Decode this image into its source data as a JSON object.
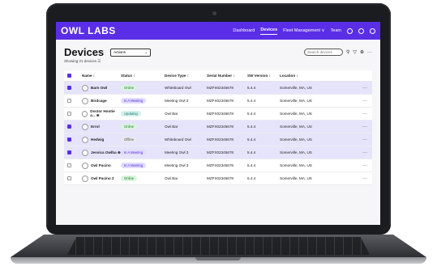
{
  "topbar": {
    "logo": "OWL LABS",
    "nav": [
      "Dashboard",
      "Devices",
      "Fleet Management ∨",
      "Team"
    ]
  },
  "page": {
    "title": "Devices",
    "actions_label": "Actions",
    "search_placeholder": "Search devices",
    "subtitle": "Showing 21 devices ☰"
  },
  "table": {
    "columns": [
      "",
      "Name ↕",
      "Status ↕",
      "Device Type ↕",
      "Serial Number ↕",
      "SW Version ↕",
      "Location ↕",
      ""
    ],
    "rows": [
      {
        "name": "Barn Owl",
        "status": "Online",
        "type": "Whiteboard Owl",
        "serial": "MZFX02345678",
        "sw": "5.4.4",
        "location": "Somerville, MA, US",
        "selected": true
      },
      {
        "name": "Birdcage",
        "status": "In A Meeting",
        "type": "Meeting Owl 3",
        "serial": "MZFX02345678",
        "sw": "5.4.4",
        "location": "Somerville, MA, US",
        "selected": false
      },
      {
        "name": "Doctor Hootie a... ⊕",
        "status": "Updating",
        "type": "Owl Bar",
        "serial": "MZFX02345678",
        "sw": "5.4.4",
        "location": "Somerville, MA, US",
        "selected": false
      },
      {
        "name": "Errol",
        "status": "Online",
        "type": "Owl Bar",
        "serial": "MZFX02345678",
        "sw": "5.4.4",
        "location": "Somerville, MA, US",
        "selected": true
      },
      {
        "name": "Hedwig",
        "status": "Offline",
        "type": "Whiteboard Owl",
        "serial": "MZFX02345678",
        "sw": "5.4.4",
        "location": "Somerville, MA, US",
        "selected": true
      },
      {
        "name": "Jessica Owlba ⊕",
        "status": "In A Meeting",
        "type": "Meeting Owl 3",
        "serial": "MZFX02345678",
        "sw": "5.4.4",
        "location": "Somerville, MA, US",
        "selected": true
      },
      {
        "name": "Owl Pacino",
        "status": "In A Meeting",
        "type": "Meeting Owl 3",
        "serial": "MZFX02345678",
        "sw": "5.4.4",
        "location": "Somerville, MA, US",
        "selected": false
      },
      {
        "name": "Owl Pacino 2",
        "status": "Online",
        "type": "Owl Bar",
        "serial": "MZFX02345678",
        "sw": "5.4.4",
        "location": "Somerville, MA, US",
        "selected": false
      }
    ],
    "status_colors": {
      "Online": {
        "bg": "#d9f5dd",
        "fg": "#1f7a32"
      },
      "In A Meeting": {
        "bg": "#e3dcff",
        "fg": "#4a2bd0"
      },
      "Updating": {
        "bg": "#d5f1ee",
        "fg": "#1e7a70"
      },
      "Offline": {
        "bg": "#e9e9ec",
        "fg": "#555555"
      }
    },
    "more_label": "···"
  }
}
